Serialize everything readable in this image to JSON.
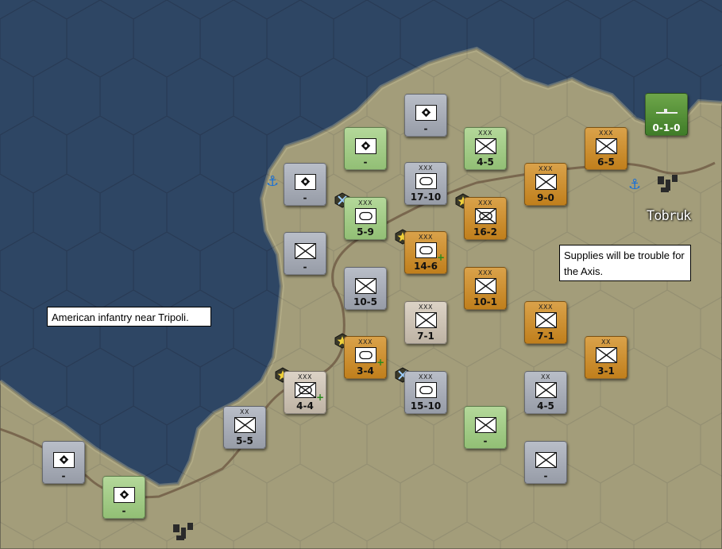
{
  "map": {
    "city": "Tobruk",
    "notes": {
      "tripoli": "American infantry near Tripoli.",
      "supplies": "Supplies will be trouble for the Axis."
    }
  },
  "units": [
    {
      "name": "unit-hq-allied-1",
      "faction": "allied",
      "type": "hq",
      "size": "",
      "value": "-"
    },
    {
      "name": "unit-hq-neutral-1",
      "faction": "neutral",
      "type": "hq",
      "size": "",
      "value": "-"
    },
    {
      "name": "unit-hq-neutral-2",
      "faction": "neutral",
      "type": "hq",
      "size": "",
      "value": "-"
    },
    {
      "name": "unit-infantry-allied-1",
      "faction": "allied",
      "type": "infantry",
      "size": "XXX",
      "value": "4-5"
    },
    {
      "name": "unit-infantry-axis-1",
      "faction": "axis",
      "type": "infantry",
      "size": "XXX",
      "value": "6-5"
    },
    {
      "name": "unit-armor-neutral-1",
      "faction": "neutral",
      "type": "armor",
      "size": "XXX",
      "value": "17-10"
    },
    {
      "name": "unit-infantry-axis-2",
      "faction": "axis",
      "type": "infantry",
      "size": "XXX",
      "value": "9-0"
    },
    {
      "name": "unit-armor-allied-1",
      "faction": "allied",
      "type": "armor",
      "size": "XXX",
      "value": "5-9"
    },
    {
      "name": "unit-mech-axis-1",
      "faction": "axis",
      "type": "mech-infantry",
      "size": "XXX",
      "value": "16-2"
    },
    {
      "name": "unit-armor-axis-1",
      "faction": "axis",
      "type": "armor",
      "size": "XXX",
      "value": "14-6"
    },
    {
      "name": "unit-infantry-neutral-1",
      "faction": "neutral",
      "type": "infantry",
      "size": "",
      "value": "-"
    },
    {
      "name": "unit-infantry-neutral-2",
      "faction": "neutral",
      "type": "infantry",
      "size": "",
      "value": "10-5"
    },
    {
      "name": "unit-infantry-axis-3",
      "faction": "axis",
      "type": "infantry",
      "size": "XXX",
      "value": "10-1"
    },
    {
      "name": "unit-infantry-vichy-1",
      "faction": "vichy",
      "type": "infantry",
      "size": "XXX",
      "value": "7-1"
    },
    {
      "name": "unit-infantry-axis-4",
      "faction": "axis",
      "type": "infantry",
      "size": "XXX",
      "value": "7-1"
    },
    {
      "name": "unit-armor-axis-2",
      "faction": "axis",
      "type": "armor",
      "size": "XXX",
      "value": "3-4"
    },
    {
      "name": "unit-infantry-axis-5",
      "faction": "axis",
      "type": "infantry",
      "size": "XX",
      "value": "3-1"
    },
    {
      "name": "unit-mech-vichy-1",
      "faction": "vichy",
      "type": "mech-infantry",
      "size": "XXX",
      "value": "4-4"
    },
    {
      "name": "unit-armor-neutral-2",
      "faction": "neutral",
      "type": "armor",
      "size": "XXX",
      "value": "15-10"
    },
    {
      "name": "unit-infantry-neutral-3",
      "faction": "neutral",
      "type": "infantry",
      "size": "XX",
      "value": "4-5"
    },
    {
      "name": "unit-infantry-neutral-4",
      "faction": "neutral",
      "type": "infantry",
      "size": "XX",
      "value": "5-5"
    },
    {
      "name": "unit-infantry-allied-2",
      "faction": "allied",
      "type": "infantry",
      "size": "",
      "value": "-"
    },
    {
      "name": "unit-hq-neutral-3",
      "faction": "neutral",
      "type": "hq",
      "size": "",
      "value": "-"
    },
    {
      "name": "unit-infantry-neutral-5",
      "faction": "neutral",
      "type": "infantry",
      "size": "",
      "value": "-"
    },
    {
      "name": "unit-hq-allied-2",
      "faction": "allied",
      "type": "hq",
      "size": "",
      "value": "-"
    },
    {
      "name": "unit-ship-allied-1",
      "faction": "allied-naval",
      "type": "submarine",
      "size": "",
      "value": "0-1-0"
    }
  ],
  "colors": {
    "sea": "#2d4461",
    "land": "#a39d7a",
    "allied": "#a6cf8a",
    "neutral": "#a9aeb8",
    "axis": "#cf8f33",
    "vichy": "#d3c9bb",
    "naval": "#56913a",
    "port": "#1a70d6"
  }
}
